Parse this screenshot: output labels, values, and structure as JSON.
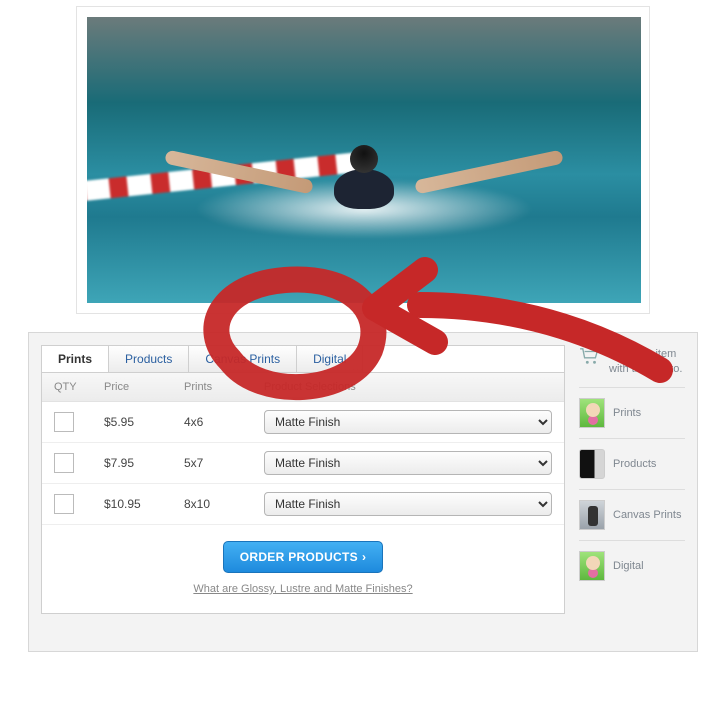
{
  "tabs": [
    {
      "label": "Prints",
      "active": true
    },
    {
      "label": "Products",
      "active": false
    },
    {
      "label": "Canvas Prints",
      "active": false
    },
    {
      "label": "Digital",
      "active": false
    }
  ],
  "columns": {
    "qty": "QTY",
    "price": "Price",
    "prints": "Prints",
    "selections": "Product Selections"
  },
  "rows": [
    {
      "price": "$5.95",
      "size": "4x6",
      "finish": "Matte Finish"
    },
    {
      "price": "$7.95",
      "size": "5x7",
      "finish": "Matte Finish"
    },
    {
      "price": "$10.95",
      "size": "8x10",
      "finish": "Matte Finish"
    }
  ],
  "order_button": "ORDER PRODUCTS",
  "finishes_link": "What are Glossy, Lustre and Matte Finishes?",
  "sidebar": {
    "hint": "Order an item with this photo.",
    "items": [
      {
        "label": "Prints",
        "thumb": "kid"
      },
      {
        "label": "Products",
        "thumb": "mug"
      },
      {
        "label": "Canvas Prints",
        "thumb": "ath"
      },
      {
        "label": "Digital",
        "thumb": "kid"
      }
    ]
  }
}
